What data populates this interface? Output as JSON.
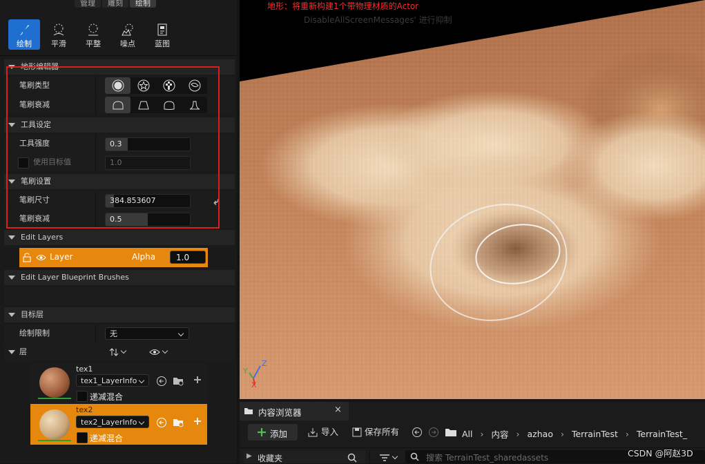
{
  "mode_tabs": [
    "管理",
    "雕刻",
    "绘制"
  ],
  "tools": [
    {
      "label": "绘制",
      "icon": "paintbrush-icon"
    },
    {
      "label": "平滑",
      "icon": "smooth-icon"
    },
    {
      "label": "平整",
      "icon": "flatten-icon"
    },
    {
      "label": "噪点",
      "icon": "noise-icon"
    },
    {
      "label": "蓝图",
      "icon": "blueprint-icon"
    }
  ],
  "terrain_editor": {
    "title": "地形编辑器",
    "brush_type_label": "笔刷类型",
    "brush_falloff_label": "笔刷衰减"
  },
  "tool_settings": {
    "title": "工具设定",
    "strength_label": "工具强度",
    "strength_value": "0.3",
    "use_target_label": "使用目标值",
    "target_value": "1.0"
  },
  "brush_settings": {
    "title": "笔刷设置",
    "size_label": "笔刷尺寸",
    "size_value": "384.853607",
    "falloff_label": "笔刷衰减",
    "falloff_value": "0.5"
  },
  "edit_layers": {
    "title": "Edit Layers",
    "layer_name": "Layer",
    "alpha_label": "Alpha",
    "alpha_value": "1.0"
  },
  "edit_layer_bp": {
    "title": "Edit Layer Blueprint Brushes"
  },
  "target_layers": {
    "title": "目标层",
    "paint_restriction_label": "绘制限制",
    "paint_restriction_value": "无",
    "layers_label": "层",
    "items": [
      {
        "name": "tex1",
        "info": "tex1_LayerInfo",
        "blend_label": "递减混合",
        "selected": false
      },
      {
        "name": "tex2",
        "info": "tex2_LayerInfo",
        "blend_label": "递减混合",
        "selected": true
      }
    ]
  },
  "viewport": {
    "warning_line1": "地形：将重新构建1个带物理材质的Actor",
    "warning_line2": "DisableAllScreenMessages' 进行抑制",
    "axis_z": "Z",
    "axis_y": "Y",
    "axis_x": "X"
  },
  "content_browser": {
    "tab_title": "内容浏览器",
    "add_label": "添加",
    "import_label": "导入",
    "save_all_label": "保存所有",
    "breadcrumb": [
      "All",
      "内容",
      "azhao",
      "TerrainTest",
      "TerrainTest_"
    ],
    "favorites_label": "收藏夹",
    "search_placeholder": "搜索 TerrainTest_sharedassets"
  },
  "watermark": "CSDN @阿赵3D",
  "colors": {
    "accent_blue": "#1f6fd0",
    "highlight_orange": "#e6880d",
    "red_frame": "#e01d1d",
    "warning_red": "#ff2a2a"
  }
}
